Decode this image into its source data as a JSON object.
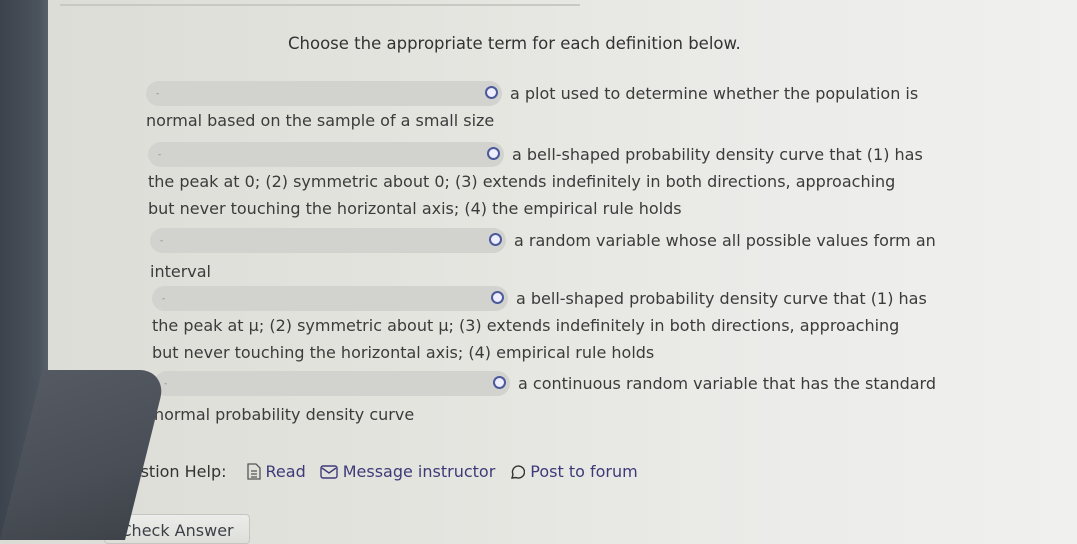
{
  "instructions": "Choose the appropriate term for each definition below.",
  "items": [
    {
      "selected": "-",
      "line1": "a plot used to determine whether the population is",
      "rest": [
        "normal based on the sample of a small size"
      ]
    },
    {
      "selected": "-",
      "line1": "a bell-shaped probability density curve that (1) has",
      "rest": [
        "the peak at 0; (2) symmetric about 0; (3) extends indefinitely in both directions, approaching",
        "but never touching the horizontal axis; (4) the empirical rule holds"
      ]
    },
    {
      "selected": "-",
      "line1": "a random variable whose all possible values form an",
      "rest": [
        "interval"
      ]
    },
    {
      "selected": "-",
      "line1": "a bell-shaped probability density curve that (1) has",
      "rest": [
        "the peak at μ; (2) symmetric about μ; (3) extends indefinitely in both directions, approaching",
        "but never touching the horizontal axis; (4) empirical rule holds"
      ]
    },
    {
      "selected": "-",
      "line1": "a continuous random variable that has the standard",
      "rest": [
        "normal probability density curve"
      ]
    }
  ],
  "help": {
    "label": "Question Help:",
    "read": "Read",
    "message": "Message instructor",
    "forum": "Post to forum"
  },
  "check_answer": "Check Answer",
  "colors": {
    "link": "#3e3a78",
    "select_bg": "#d2d2cf",
    "select_icon": "#4a5a9a"
  }
}
